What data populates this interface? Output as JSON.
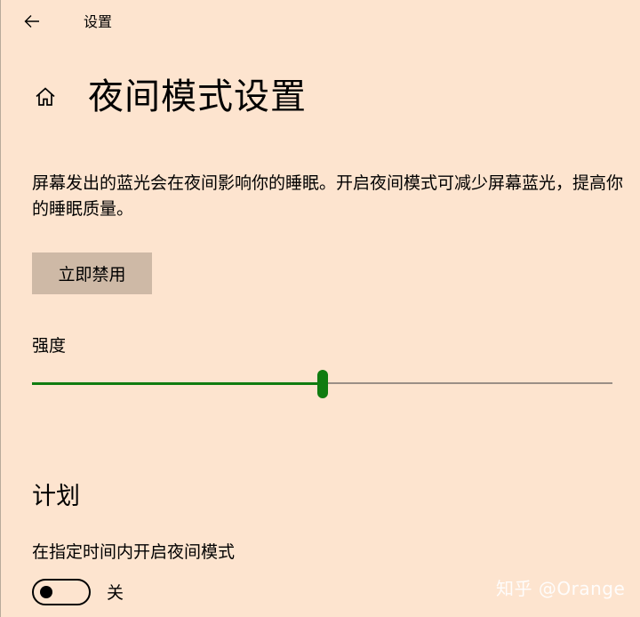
{
  "window": {
    "title": "设置"
  },
  "header": {
    "back_icon": "arrow-left-icon",
    "home_icon": "home-icon",
    "title": "夜间模式设置"
  },
  "main": {
    "description": "屏幕发出的蓝光会在夜间影响你的睡眠。开启夜间模式可减少屏幕蓝光，提高你的睡眠质量。",
    "disable_now_label": "立即禁用",
    "strength": {
      "label": "强度",
      "value_fraction": 0.5
    },
    "schedule": {
      "section_title": "计划",
      "toggle_label": "在指定时间内开启夜间模式",
      "toggle_state": "关",
      "toggle_on": false
    }
  },
  "watermark": "知乎 @Orange",
  "colors": {
    "background": "#fde4cf",
    "button_background": "#ceb9a6",
    "accent": "#107c10",
    "track": "#9a8f86"
  }
}
